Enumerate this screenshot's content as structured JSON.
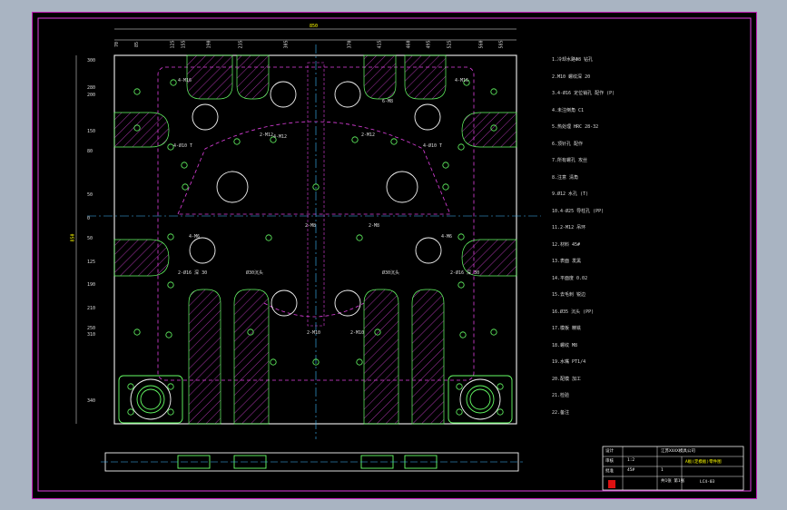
{
  "drawing": {
    "overall_dimension": "850",
    "side_dimension": "850",
    "dim_values_top": [
      "70",
      "85",
      "125",
      "155",
      "190",
      "235",
      "305",
      "370",
      "415",
      "460",
      "495",
      "525",
      "560",
      "585"
    ],
    "dim_values_left": [
      "300",
      "280",
      "200",
      "150",
      "80",
      "50",
      "0",
      "50",
      "125",
      "190",
      "210",
      "250",
      "310",
      "340"
    ],
    "hole_tags": [
      "4-M16",
      "4-M16",
      "2-M12",
      "2-M12",
      "4-M12",
      "2-M8",
      "2-M8",
      "4-M6",
      "4-M6",
      "2-M10",
      "2-M10",
      "6-M8"
    ],
    "callouts": [
      "2-Ø16 深 30",
      "2-Ø16 深 30",
      "Ø30沉头",
      "Ø30沉头",
      "4-Ø10 T",
      "4-Ø10 T"
    ]
  },
  "notes": {
    "lines": [
      "1.冷却水路Φ8 钻孔",
      "2.M10 螺纹深 20",
      "3.4-Ø16 定位销孔 配作 (P)",
      "4.未注倒角 C1",
      "5.热处理 HRC 28-32",
      "6.顶针孔 配作",
      "7.所有螺孔 攻丝",
      "8.注意 清角",
      "9.Ø12 水孔 (T)",
      "10.4-Ø25 导柱孔 (PP)",
      "11.2-M12 吊环",
      "12.材料 45#",
      "13.表面 发黑",
      "14.平面度 0.02",
      "15.去毛刺 锐边",
      "16.Ø35 沉头 (PP)",
      "17.模板 精铣",
      "18.螺纹 M8",
      "19.水嘴 PT1/4",
      "20.配模 加工",
      "21.检验",
      "22.备注"
    ]
  },
  "title_block": {
    "design_label": "设计",
    "check_label": "审核",
    "approve_label": "批准",
    "company": "江苏XXXX模具公司",
    "title": "A板(定模板)零件图",
    "drawing_no": "LC4-03",
    "sheet_label": "共1张 第1张",
    "scale": "1:2",
    "material": "45#",
    "qty": "1"
  }
}
